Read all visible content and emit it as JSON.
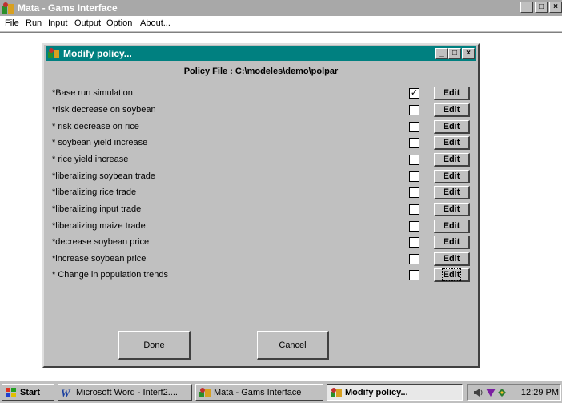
{
  "window": {
    "title": "Mata - Gams Interface",
    "controls": {
      "minimize": "_",
      "maximize": "□",
      "close": "×"
    }
  },
  "menu": [
    {
      "label": "File"
    },
    {
      "label": "Run"
    },
    {
      "label": "Input"
    },
    {
      "label": "Output"
    },
    {
      "label": "Option"
    },
    {
      "label": "About..."
    }
  ],
  "dialog": {
    "title": "Modify policy...",
    "policy_file": "Policy File : C:\\modeles\\demo\\polpar",
    "edit_label": "Edit",
    "policies": [
      {
        "label": "*Base run simulation",
        "checked": true
      },
      {
        "label": "*risk decrease on soybean",
        "checked": false
      },
      {
        "label": "* risk decrease on rice",
        "checked": false
      },
      {
        "label": "* soybean yield increase",
        "checked": false
      },
      {
        "label": "* rice yield increase",
        "checked": false
      },
      {
        "label": "*liberalizing soybean trade",
        "checked": false
      },
      {
        "label": "*liberalizing rice trade",
        "checked": false
      },
      {
        "label": "*liberalizing input trade",
        "checked": false
      },
      {
        "label": "*liberalizing maize trade",
        "checked": false
      },
      {
        "label": "*decrease soybean price",
        "checked": false
      },
      {
        "label": "*increase soybean price",
        "checked": false
      },
      {
        "label": "* Change in population trends",
        "checked": false
      }
    ],
    "done_label": "Done",
    "cancel_label": "Cancel"
  },
  "taskbar": {
    "start_label": "Start",
    "tasks": [
      {
        "label": "Microsoft Word - Interf2....",
        "active": false
      },
      {
        "label": "Mata - Gams Interface",
        "active": false
      },
      {
        "label": "Modify policy...",
        "active": true
      }
    ],
    "clock": "12:29 PM"
  },
  "colors": {
    "dialog_title_bg": "#008080",
    "inactive_title_bg": "#a8a8a8",
    "face": "#c0c0c0"
  }
}
